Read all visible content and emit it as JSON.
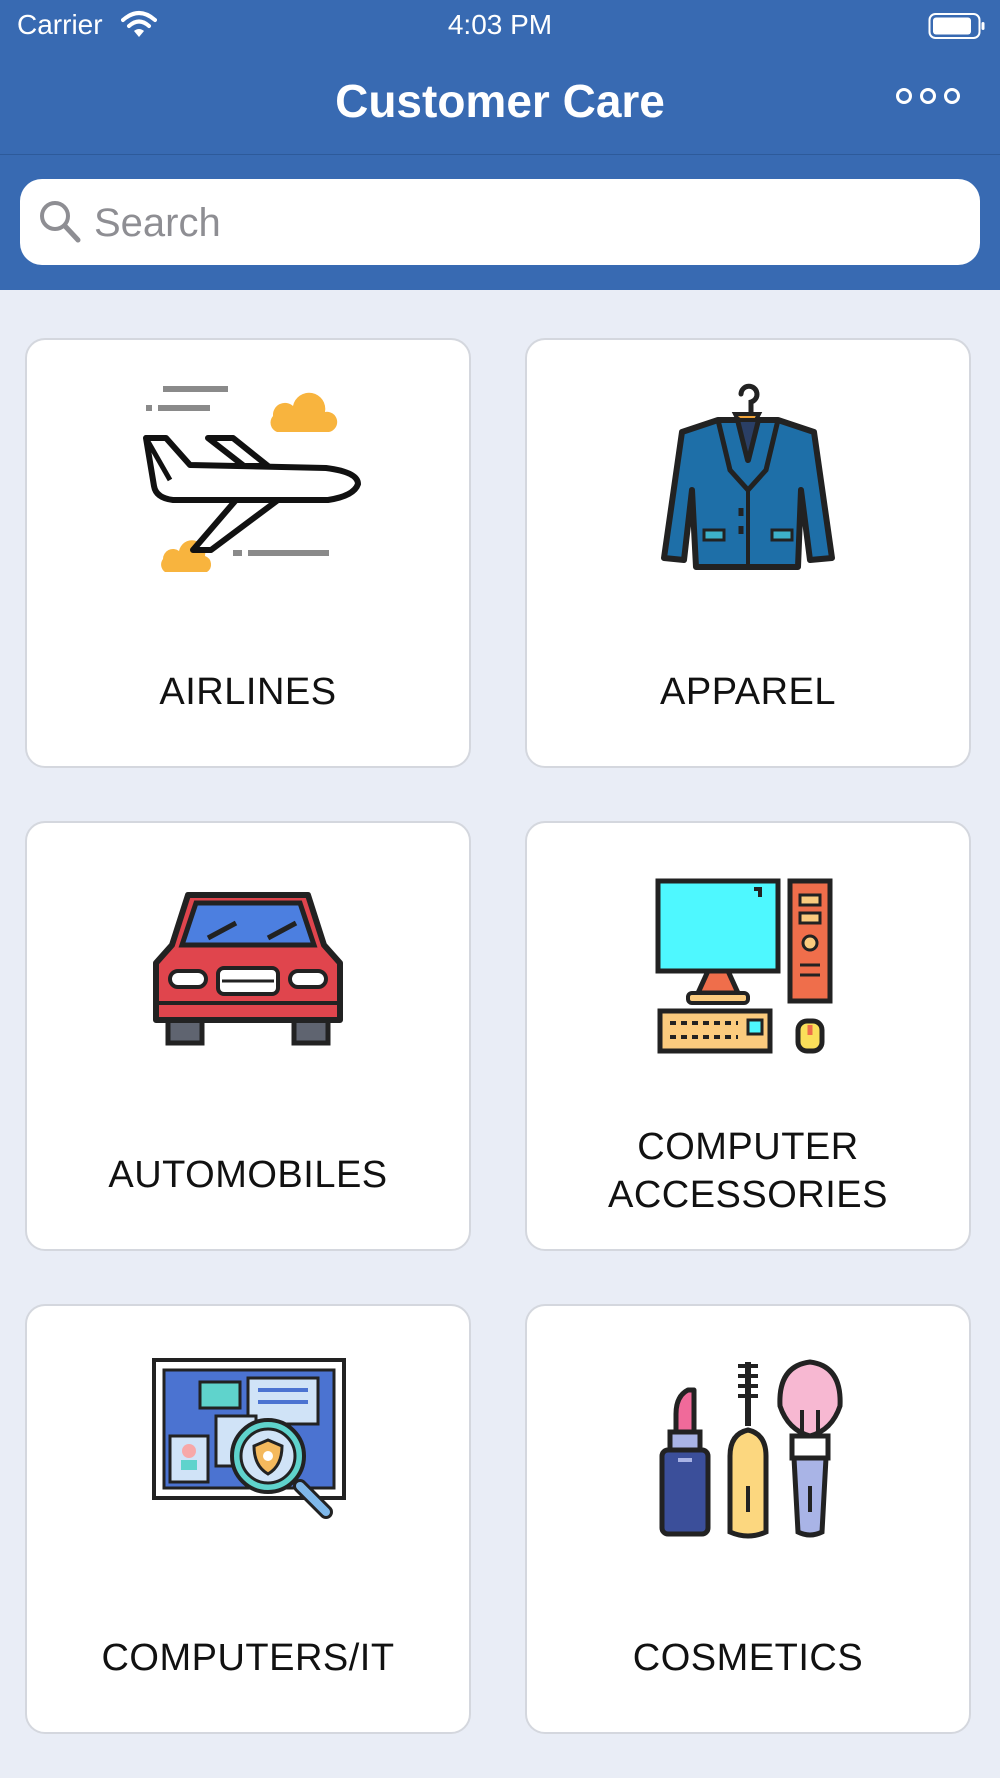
{
  "status_bar": {
    "carrier": "Carrier",
    "time": "4:03 PM"
  },
  "nav": {
    "title": "Customer Care",
    "more_icon": "ellipsis-circles-icon"
  },
  "search": {
    "placeholder": "Search",
    "value": ""
  },
  "colors": {
    "header": "#386ab2",
    "background": "#e9edf6",
    "tile": "#ffffff"
  },
  "categories": [
    {
      "label": "AIRLINES",
      "icon": "airplane-icon"
    },
    {
      "label": "APPAREL",
      "icon": "jacket-icon"
    },
    {
      "label": "AUTOMOBILES",
      "icon": "car-icon"
    },
    {
      "label_line1": "COMPUTER",
      "label_line2": "ACCESSORIES",
      "icon": "desktop-computer-icon"
    },
    {
      "label": "COMPUTERS/IT",
      "icon": "screen-magnifier-icon"
    },
    {
      "label": "COSMETICS",
      "icon": "makeup-icon"
    }
  ]
}
